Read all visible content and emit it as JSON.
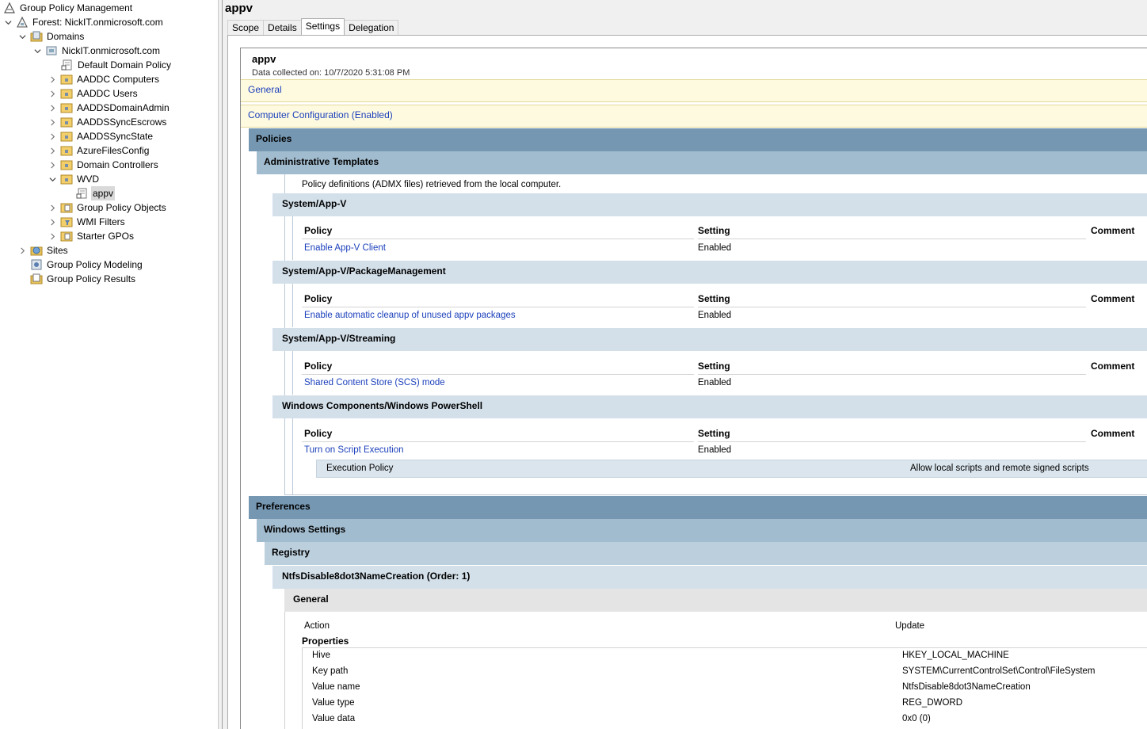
{
  "tree": {
    "root_label": "Group Policy Management",
    "forest_label": "Forest: NickIT.onmicrosoft.com",
    "domains_label": "Domains",
    "domain_label": "NickIT.onmicrosoft.com",
    "items": [
      "Default Domain Policy",
      "AADDC Computers",
      "AADDC Users",
      "AADDSDomainAdmin",
      "AADDSSyncEscrows",
      "AADDSSyncState",
      "AzureFilesConfig",
      "Domain Controllers",
      "WVD"
    ],
    "selected_label": "appv",
    "after_items": [
      "Group Policy Objects",
      "WMI Filters",
      "Starter GPOs"
    ],
    "sites_label": "Sites",
    "modeling_label": "Group Policy Modeling",
    "results_label": "Group Policy Results"
  },
  "header": {
    "title": "appv",
    "tabs": [
      "Scope",
      "Details",
      "Settings",
      "Delegation"
    ],
    "active_tab": "Settings"
  },
  "report": {
    "title": "appv",
    "collected": "Data collected on: 10/7/2020 5:31:08 PM",
    "general_link": "General",
    "computer_config_link": "Computer Configuration (Enabled)",
    "policies": "Policies",
    "admin_templates": "Administrative Templates",
    "admx_note": "Policy definitions (ADMX files) retrieved from the local computer.",
    "col_policy": "Policy",
    "col_setting": "Setting",
    "col_comment": "Comment",
    "sections": [
      {
        "title": "System/App-V",
        "policy": "Enable App-V Client",
        "setting": "Enabled"
      },
      {
        "title": "System/App-V/PackageManagement",
        "policy": "Enable automatic cleanup of unused appv packages",
        "setting": "Enabled"
      },
      {
        "title": "System/App-V/Streaming",
        "policy": "Shared Content Store (SCS) mode",
        "setting": "Enabled"
      },
      {
        "title": "Windows Components/Windows PowerShell",
        "policy": "Turn on Script Execution",
        "setting": "Enabled"
      }
    ],
    "execution_policy_label": "Execution Policy",
    "execution_policy_value": "Allow local scripts and remote signed scripts",
    "preferences": "Preferences",
    "windows_settings": "Windows Settings",
    "registry": "Registry",
    "registry_item": "NtfsDisable8dot3NameCreation (Order: 1)",
    "general_sub": "General",
    "action_label": "Action",
    "action_value": "Update",
    "properties_label": "Properties",
    "properties": [
      {
        "name": "Hive",
        "value": "HKEY_LOCAL_MACHINE"
      },
      {
        "name": "Key path",
        "value": "SYSTEM\\CurrentControlSet\\Control\\FileSystem"
      },
      {
        "name": "Value name",
        "value": "NtfsDisable8dot3NameCreation"
      },
      {
        "name": "Value type",
        "value": "REG_DWORD"
      },
      {
        "name": "Value data",
        "value": "0x0 (0)"
      }
    ]
  },
  "colors": {
    "link": "#1a3fbb",
    "band_dark": "#7597b2",
    "band_mid": "#a2bccf",
    "band_light": "#d3e0ea",
    "yellow": "#fefae0"
  }
}
